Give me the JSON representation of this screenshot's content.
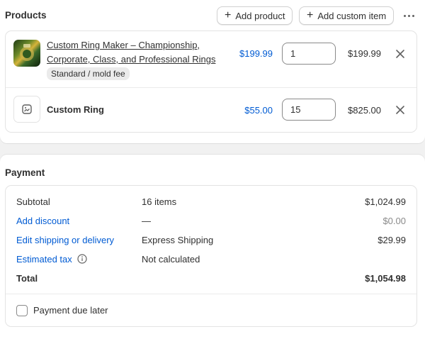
{
  "products": {
    "heading": "Products",
    "add_product_label": "Add product",
    "add_custom_item_label": "Add custom item",
    "items": [
      {
        "name_line1": "Custom Ring Maker – Championship,",
        "name_line2": "Corporate, Class, and Professional Rings",
        "variant": "Standard / mold fee",
        "price": "$199.99",
        "quantity": "1",
        "total": "$199.99"
      },
      {
        "name_line1": "Custom Ring",
        "price": "$55.00",
        "quantity": "15",
        "total": "$825.00"
      }
    ]
  },
  "payment": {
    "heading": "Payment",
    "subtotal": {
      "label": "Subtotal",
      "detail": "16 items",
      "value": "$1,024.99"
    },
    "discount": {
      "label": "Add discount",
      "detail": "—",
      "value": "$0.00"
    },
    "shipping": {
      "label": "Edit shipping or delivery",
      "detail": "Express Shipping",
      "value": "$29.99"
    },
    "tax": {
      "label": "Estimated tax",
      "detail": "Not calculated"
    },
    "total": {
      "label": "Total",
      "value": "$1,054.98"
    },
    "due_later_label": "Payment due later"
  },
  "colors": {
    "link": "#005bd3",
    "text": "#303030",
    "muted": "#8a8a8a",
    "border": "#e3e3e3",
    "background": "#f1f1f1"
  }
}
